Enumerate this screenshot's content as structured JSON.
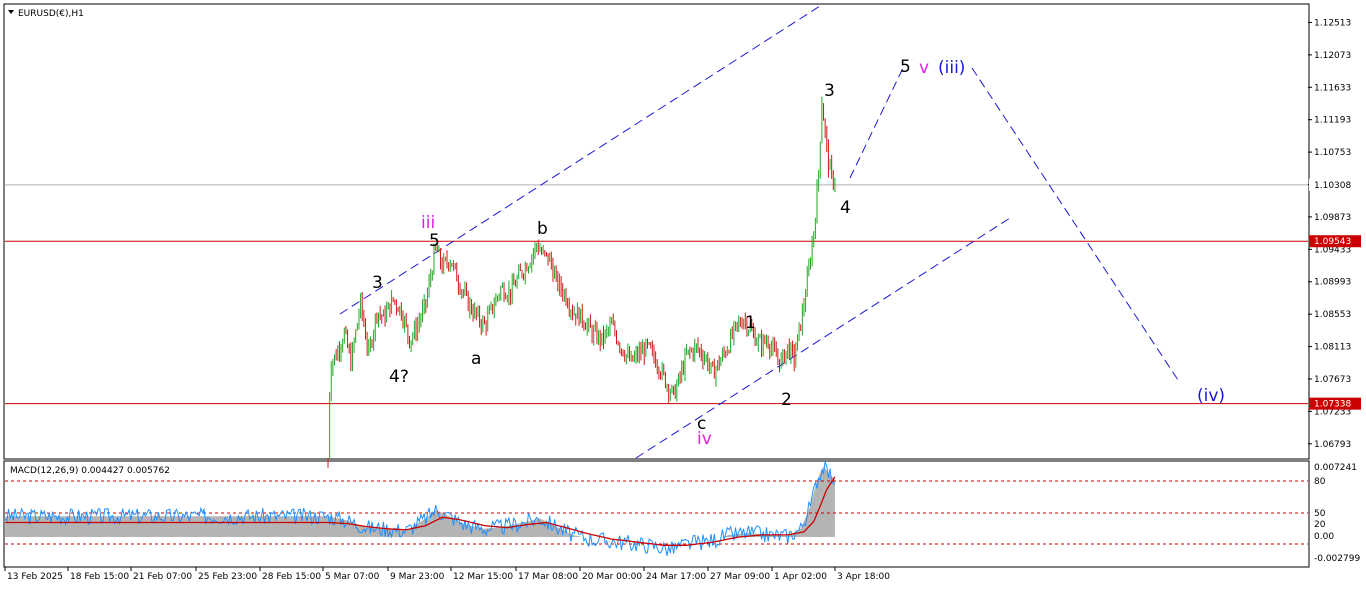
{
  "window": {
    "title": "EURUSD(€),H1"
  },
  "indicator": {
    "title": "MACD(12,26,9) 0.004427 0.005762"
  },
  "price_scale": {
    "ticks": [
      "1.12513",
      "1.12073",
      "1.11633",
      "1.11193",
      "1.10753",
      "1.10313",
      "1.09873",
      "1.09433",
      "1.08993",
      "1.08553",
      "1.08113",
      "1.07673",
      "1.07233",
      "1.06793"
    ],
    "current_price_label": "1.10308",
    "resistance_label": "1.09543",
    "support_label": "1.07338"
  },
  "macd_scale": {
    "ticks": [
      "0.007241",
      "80",
      "50",
      "20",
      "0.00",
      "-0.002799"
    ]
  },
  "time_scale": {
    "ticks": [
      "13 Feb 2025",
      "18 Feb 15:00",
      "21 Feb 07:00",
      "25 Feb 23:00",
      "28 Feb 15:00",
      "5 Mar 07:00",
      "9 Mar 23:00",
      "12 Mar 15:00",
      "17 Mar 08:00",
      "20 Mar 00:00",
      "24 Mar 17:00",
      "27 Mar 09:00",
      "1 Apr 02:00",
      "3 Apr 18:00"
    ]
  },
  "wave_labels": {
    "w3a": "3",
    "w4q": "4?",
    "w5a": "5",
    "iii": "iii",
    "a": "a",
    "b": "b",
    "c": "c",
    "iv": "iv",
    "w1": "1",
    "w2": "2",
    "w3b": "3",
    "w4b": "4",
    "w5b": "5",
    "v": "v",
    "big_iii": "(iii)",
    "big_iv": "(iv)"
  },
  "colors": {
    "bull_candle": "#22a822",
    "bear_candle": "#d01818",
    "level_line": "#cc0000",
    "channel_line": "#1a1ad8",
    "macd_line": "#1e90ff",
    "signal_line": "#cc0000",
    "histogram": "#b4b4b4",
    "current_price_line": "#b0b0b0"
  },
  "chart_data": {
    "type": "candlestick",
    "symbol": "EURUSD(€)",
    "timeframe": "H1",
    "y_range": [
      1.066,
      1.1275
    ],
    "levels": {
      "current": 1.10308,
      "resistance": 1.09543,
      "support": 1.07338
    },
    "price_path": [
      [
        0,
        1.064
      ],
      [
        1,
        1.075
      ],
      [
        2,
        1.079
      ],
      [
        5,
        1.08
      ],
      [
        10,
        1.083
      ],
      [
        14,
        1.079
      ],
      [
        20,
        1.087
      ],
      [
        25,
        1.08
      ],
      [
        30,
        1.086
      ],
      [
        34,
        1.085
      ],
      [
        40,
        1.0875
      ],
      [
        45,
        1.086
      ],
      [
        50,
        1.082
      ],
      [
        54,
        1.0835
      ],
      [
        60,
        1.087
      ],
      [
        66,
        1.0945
      ],
      [
        70,
        1.092
      ],
      [
        75,
        1.093
      ],
      [
        80,
        1.09
      ],
      [
        86,
        1.087
      ],
      [
        92,
        1.085
      ],
      [
        96,
        1.084
      ],
      [
        100,
        1.086
      ],
      [
        106,
        1.089
      ],
      [
        112,
        1.0885
      ],
      [
        118,
        1.091
      ],
      [
        124,
        1.093
      ],
      [
        128,
        1.095
      ],
      [
        132,
        1.0935
      ],
      [
        136,
        1.093
      ],
      [
        140,
        1.09
      ],
      [
        146,
        1.088
      ],
      [
        150,
        1.086
      ],
      [
        156,
        1.085
      ],
      [
        162,
        1.083
      ],
      [
        168,
        1.082
      ],
      [
        174,
        1.084
      ],
      [
        180,
        1.081
      ],
      [
        186,
        1.079
      ],
      [
        190,
        1.08
      ],
      [
        196,
        1.081
      ],
      [
        202,
        1.079
      ],
      [
        208,
        1.076
      ],
      [
        212,
        1.0745
      ],
      [
        216,
        1.077
      ],
      [
        220,
        1.08
      ],
      [
        226,
        1.081
      ],
      [
        232,
        1.0795
      ],
      [
        236,
        1.0775
      ],
      [
        240,
        1.079
      ],
      [
        245,
        1.081
      ],
      [
        250,
        1.0835
      ],
      [
        255,
        1.085
      ],
      [
        260,
        1.083
      ],
      [
        265,
        1.0815
      ],
      [
        270,
        1.082
      ],
      [
        274,
        1.08
      ],
      [
        278,
        1.079
      ],
      [
        282,
        1.081
      ],
      [
        286,
        1.0795
      ],
      [
        288,
        1.082
      ],
      [
        291,
        1.0855
      ],
      [
        294,
        1.09
      ],
      [
        297,
        1.095
      ],
      [
        299,
        1.099
      ],
      [
        301,
        1.105
      ],
      [
        303,
        1.1145
      ],
      [
        305,
        1.11
      ],
      [
        307,
        1.106
      ],
      [
        309,
        1.104
      ],
      [
        311,
        1.1035
      ]
    ],
    "macd_range": [
      -0.002799,
      0.007241
    ],
    "macd_path": [
      [
        0,
        0.002
      ],
      [
        12,
        0.0016
      ],
      [
        24,
        0.0009
      ],
      [
        36,
        0.0008
      ],
      [
        48,
        0.0006
      ],
      [
        60,
        0.0018
      ],
      [
        66,
        0.0026
      ],
      [
        72,
        0.0022
      ],
      [
        84,
        0.0012
      ],
      [
        96,
        0.0008
      ],
      [
        108,
        0.001
      ],
      [
        120,
        0.0014
      ],
      [
        130,
        0.0018
      ],
      [
        140,
        0.001
      ],
      [
        150,
        0.0002
      ],
      [
        162,
        -0.0002
      ],
      [
        174,
        -0.0004
      ],
      [
        186,
        -0.0006
      ],
      [
        198,
        -0.0008
      ],
      [
        210,
        -0.0012
      ],
      [
        222,
        -0.0006
      ],
      [
        234,
        -0.0004
      ],
      [
        246,
        0.0002
      ],
      [
        258,
        0.0004
      ],
      [
        270,
        0.0002
      ],
      [
        282,
        0.0001
      ],
      [
        290,
        0.0008
      ],
      [
        296,
        0.003
      ],
      [
        300,
        0.0055
      ],
      [
        304,
        0.0068
      ],
      [
        308,
        0.006
      ],
      [
        311,
        0.0056
      ]
    ],
    "signal_path": [
      [
        0,
        0.0014
      ],
      [
        12,
        0.0013
      ],
      [
        24,
        0.001
      ],
      [
        36,
        0.0008
      ],
      [
        48,
        0.0007
      ],
      [
        60,
        0.0011
      ],
      [
        70,
        0.0019
      ],
      [
        80,
        0.0017
      ],
      [
        96,
        0.0011
      ],
      [
        110,
        0.0009
      ],
      [
        122,
        0.0012
      ],
      [
        134,
        0.0014
      ],
      [
        146,
        0.0009
      ],
      [
        160,
        0.0003
      ],
      [
        174,
        -0.0002
      ],
      [
        190,
        -0.0005
      ],
      [
        206,
        -0.0008
      ],
      [
        220,
        -0.0008
      ],
      [
        236,
        -0.0005
      ],
      [
        252,
        0.0
      ],
      [
        266,
        0.0002
      ],
      [
        282,
        0.0002
      ],
      [
        292,
        0.0005
      ],
      [
        298,
        0.0015
      ],
      [
        302,
        0.003
      ],
      [
        306,
        0.0046
      ],
      [
        311,
        0.0058
      ]
    ],
    "macd_levels": [
      80,
      50,
      20
    ],
    "projection": {
      "to_target": [
        [
          311,
          1.104
        ],
        [
          326,
          1.119
        ]
      ],
      "to_iv": [
        [
          338,
          1.12
        ],
        [
          412,
          1.0775
        ]
      ]
    },
    "channel": {
      "upper": [
        [
          0,
          1.086
        ],
        [
          190,
          1.1275
        ]
      ],
      "lower": [
        [
          130,
          1.067
        ],
        [
          280,
          1.099
        ]
      ]
    }
  }
}
